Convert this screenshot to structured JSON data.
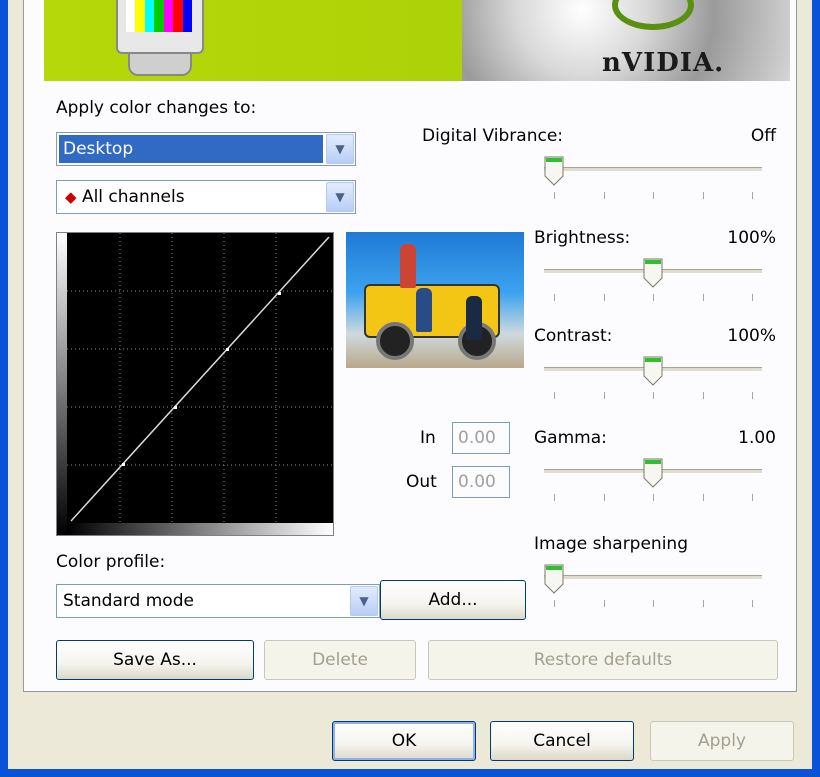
{
  "banner": {
    "brand": "nVIDIA."
  },
  "apply_color_label": "Apply color changes to:",
  "target_combo": {
    "value": "Desktop"
  },
  "channel_combo": {
    "value": "All channels"
  },
  "curve": {
    "in_label": "In",
    "in_value": "0.00",
    "out_label": "Out",
    "out_value": "0.00"
  },
  "sliders": [
    {
      "label": "Digital Vibrance:",
      "value_text": "Off",
      "level": 0.0
    },
    {
      "label": "Brightness:",
      "value_text": "100%",
      "level": 0.5
    },
    {
      "label": "Contrast:",
      "value_text": "100%",
      "level": 0.5
    },
    {
      "label": "Gamma:",
      "value_text": "1.00",
      "level": 0.5
    },
    {
      "label": "Image sharpening",
      "value_text": "",
      "level": 0.0
    }
  ],
  "color_profile": {
    "label": "Color profile:",
    "value": "Standard mode",
    "add_label": "Add..."
  },
  "actions": {
    "save_as": "Save As...",
    "delete": "Delete",
    "restore": "Restore defaults"
  },
  "dialog_buttons": {
    "ok": "OK",
    "cancel": "Cancel",
    "apply": "Apply"
  },
  "colors": {
    "xp_blue": "#0a52d8",
    "selection": "#316ac5",
    "nvidia_green": "#b5d80a",
    "slider_thumb": "#2fbf2f"
  }
}
